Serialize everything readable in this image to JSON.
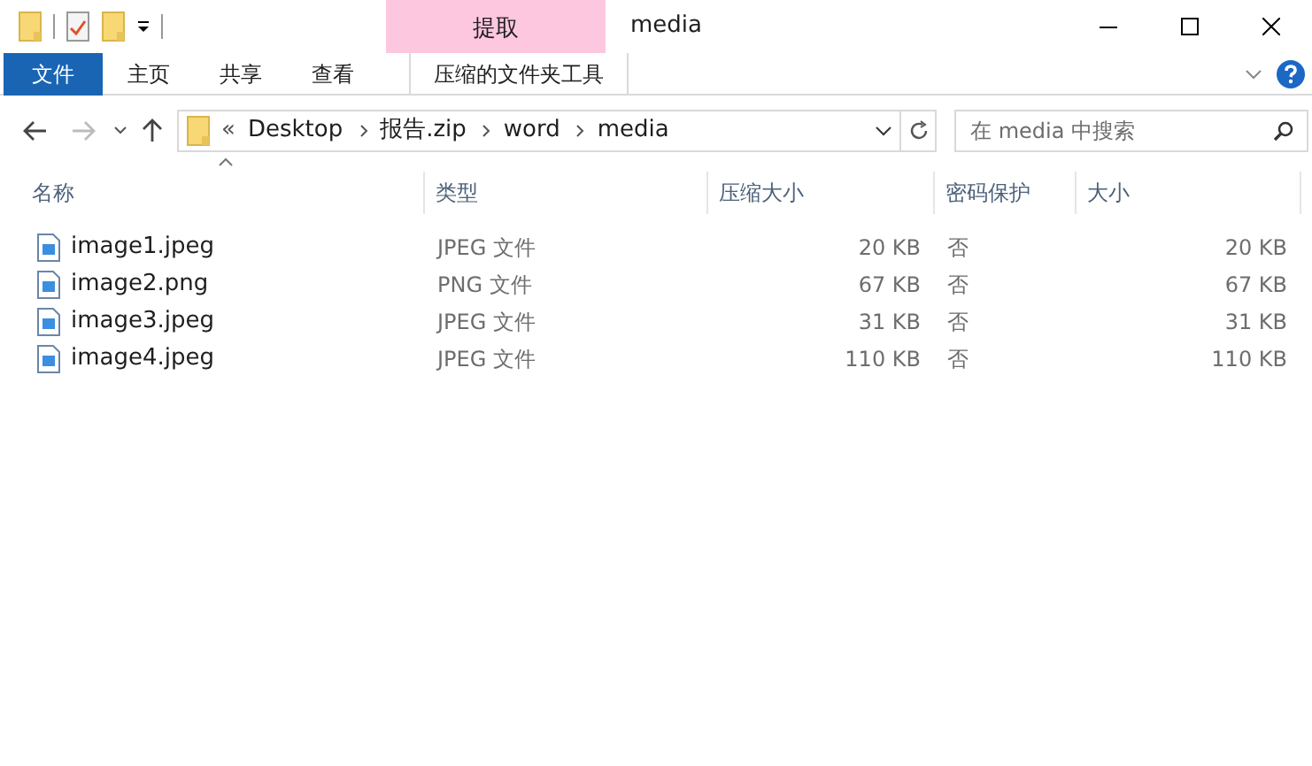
{
  "window": {
    "title": "media"
  },
  "context_tab_group": {
    "label": "提取"
  },
  "ribbon_tabs": [
    {
      "label": "文件",
      "selected": true
    },
    {
      "label": "主页",
      "selected": false
    },
    {
      "label": "共享",
      "selected": false
    },
    {
      "label": "查看",
      "selected": false
    },
    {
      "label": "压缩的文件夹工具",
      "selected": false,
      "kind": "context"
    }
  ],
  "address_bar": {
    "overflow": "«",
    "path": [
      "Desktop",
      "报告.zip",
      "word",
      "media"
    ]
  },
  "search": {
    "placeholder": "在 media 中搜索"
  },
  "table": {
    "columns": [
      "名称",
      "类型",
      "压缩大小",
      "密码保护",
      "大小"
    ],
    "rows": [
      {
        "cells": [
          "image1.jpeg",
          "JPEG 文件",
          "20 KB",
          "否",
          "20 KB"
        ]
      },
      {
        "cells": [
          "image2.png",
          "PNG 文件",
          "67 KB",
          "否",
          "67 KB"
        ]
      },
      {
        "cells": [
          "image3.jpeg",
          "JPEG 文件",
          "31 KB",
          "否",
          "31 KB"
        ]
      },
      {
        "cells": [
          "image4.jpeg",
          "JPEG 文件",
          "110 KB",
          "否",
          "110 KB"
        ]
      }
    ]
  }
}
